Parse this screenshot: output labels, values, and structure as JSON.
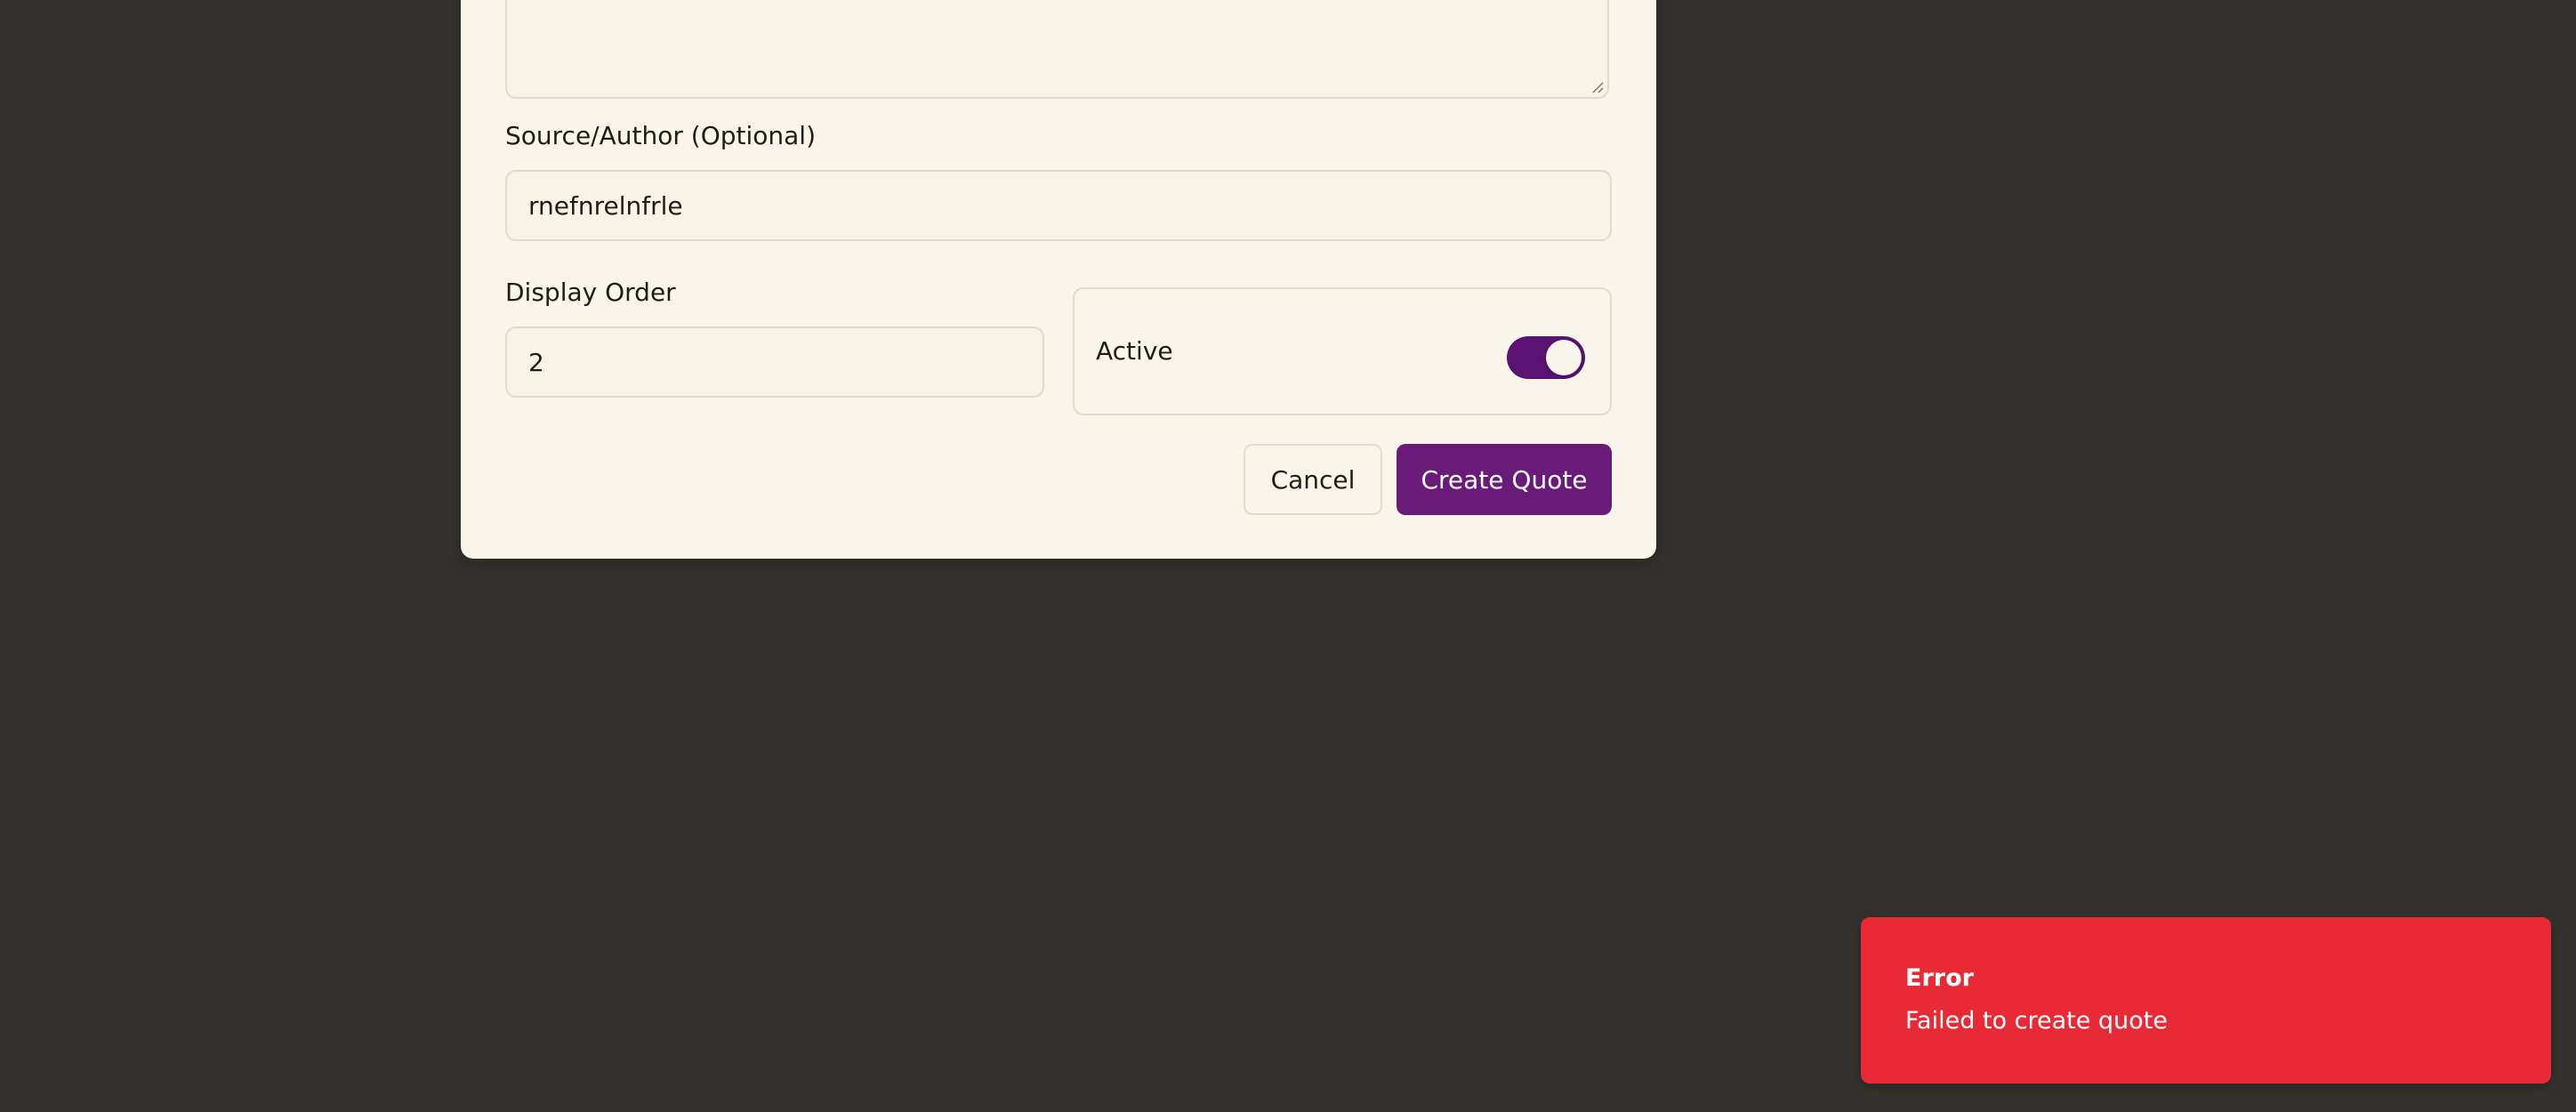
{
  "form": {
    "quote_text_value": "",
    "source_label": "Source/Author (Optional)",
    "source_value": "rnefnrelnfrle",
    "display_order_label": "Display Order",
    "display_order_value": "2",
    "active_label": "Active",
    "active_on": true
  },
  "actions": {
    "cancel_label": "Cancel",
    "create_label": "Create Quote"
  },
  "toast": {
    "title": "Error",
    "message": "Failed to create quote"
  },
  "colors": {
    "overlay": "#33322e",
    "modal_bg": "#f9f5ea",
    "accent": "#6a1b7a",
    "toggle": "#5a1273",
    "error": "#e82a36"
  }
}
